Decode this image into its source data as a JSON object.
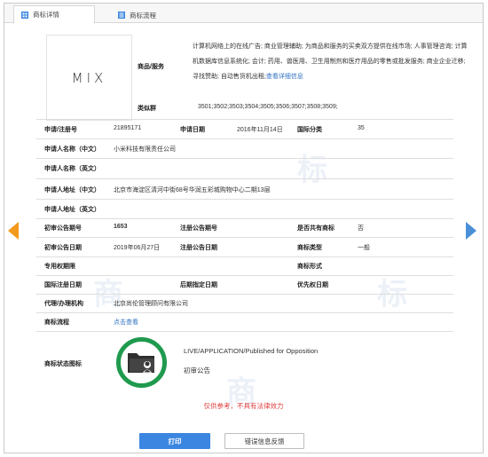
{
  "tabs": [
    {
      "label": "商标详情",
      "active": true
    },
    {
      "label": "商标流程",
      "active": false
    }
  ],
  "logo": {
    "text": "MIX"
  },
  "goods_services": {
    "label": "商品/服务",
    "text": "计算机网络上的在线广告; 商业管理辅助; 为商品和服务的买卖双方提供在线市场; 人事管理咨询; 计算机数据库信息系统化; 会计; 药用、兽医用、卫生用制剂和医疗用品的零售或批发服务; 商业企业迁移; 寻找赞助; 自动售货机出租;",
    "more_link": "查看详细信息"
  },
  "similar_group": {
    "label": "类似群",
    "value": "3501;3502;3503;3504;3505;3506;3507;3508;3509;"
  },
  "fields": {
    "reg_no_label": "申请/注册号",
    "reg_no": "21895171",
    "app_date_label": "申请日期",
    "app_date": "2016年11月14日",
    "intl_class_label": "国际分类",
    "intl_class": "35",
    "applicant_cn_label": "申请人名称（中文）",
    "applicant_cn": "小米科技有限责任公司",
    "applicant_en_label": "申请人名称（英文）",
    "applicant_en": "",
    "address_cn_label": "申请人地址（中文）",
    "address_cn": "北京市海淀区清河中街68号华润五彩城购物中心二期13层",
    "address_en_label": "申请人地址（英文）",
    "address_en": "",
    "prelim_issue_label": "初审公告期号",
    "prelim_issue": "1653",
    "reg_issue_label": "注册公告期号",
    "reg_issue": "",
    "shared_label": "是否共有商标",
    "shared": "否",
    "prelim_date_label": "初审公告日期",
    "prelim_date": "2019年06月27日",
    "reg_date_label": "注册公告日期",
    "reg_date": "",
    "tm_type_label": "商标类型",
    "tm_type": "一般",
    "exclusive_label": "专用权期限",
    "exclusive": "",
    "tm_form_label": "商标形式",
    "tm_form": "",
    "intl_reg_date_label": "国际注册日期",
    "intl_reg_date": "",
    "later_date_label": "后期指定日期",
    "later_date": "",
    "priority_label": "优先权日期",
    "priority": "",
    "agent_label": "代理/办理机构",
    "agent": "北京尚伦管理顾问有限公司",
    "process_label": "商标流程",
    "process_link": "点击查看",
    "status_label": "商标状态图标"
  },
  "status": {
    "line1": "LIVE/APPLICATION/Published for Opposition",
    "line2": "初审公告",
    "color": "#1f9a4e"
  },
  "disclaimer": "仅供参考，不具有法律效力",
  "buttons": {
    "print": "打印",
    "report": "错误信息反馈"
  },
  "colors": {
    "accent": "#3a86e0",
    "left_arrow": "#f39a1c",
    "right_arrow": "#4a90d9",
    "warning": "#e03d3d"
  }
}
